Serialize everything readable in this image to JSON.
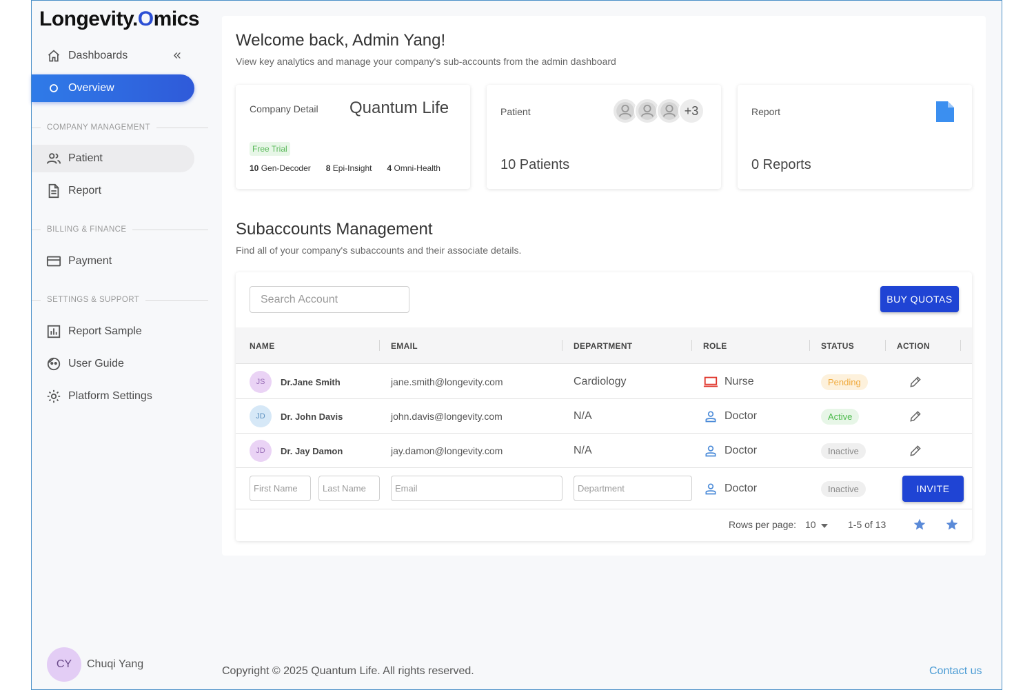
{
  "brand": {
    "part1": "Longevity.",
    "part2": "O",
    "part3": "mics"
  },
  "sidebar": {
    "dashboards": "Dashboards",
    "overview": "Overview",
    "section_company": "COMPANY MANAGEMENT",
    "patient": "Patient",
    "report": "Report",
    "section_billing": "BILLING & FINANCE",
    "payment": "Payment",
    "section_settings": "SETTINGS & SUPPORT",
    "report_sample": "Report Sample",
    "user_guide": "User Guide",
    "platform_settings": "Platform Settings",
    "user_initials": "CY",
    "user_name": "Chuqi Yang"
  },
  "header": {
    "welcome": "Welcome back, Admin Yang!",
    "subtitle": "View key analytics and manage your company's sub-accounts from the admin dashboard"
  },
  "cards": {
    "company": {
      "label": "Company Detail",
      "name": "Quantum Life",
      "badge": "Free Trial",
      "metrics": [
        {
          "count": "10",
          "name": "Gen-Decoder"
        },
        {
          "count": "8",
          "name": "Epi-Insight"
        },
        {
          "count": "4",
          "name": "Omni-Health"
        }
      ]
    },
    "patient": {
      "label": "Patient",
      "more": "+3",
      "value": "10 Patients"
    },
    "report": {
      "label": "Report",
      "value": "0 Reports"
    }
  },
  "subaccounts": {
    "title": "Subaccounts Management",
    "desc": "Find all of your company's subaccounts  and their associate details.",
    "search_placeholder": "Search Account",
    "buy_button": "BUY QUOTAS",
    "columns": [
      "NAME",
      "EMAIL",
      "DEPARTMENT",
      "ROLE",
      "STATUS",
      "ACTION"
    ],
    "rows": [
      {
        "initials": "JS",
        "name": "Dr.Jane Smith",
        "email": "jane.smith@longevity.com",
        "department": "Cardiology",
        "role": "Nurse",
        "role_icon": "laptop-icon",
        "status": "Pending"
      },
      {
        "initials": "JD",
        "name": "Dr. John Davis",
        "email": "john.davis@longevity.com",
        "department": "N/A",
        "role": "Doctor",
        "role_icon": "person-icon",
        "status": "Active"
      },
      {
        "initials": "JD",
        "name": "Dr. Jay Damon",
        "email": "jay.damon@longevity.com",
        "department": "N/A",
        "role": "Doctor",
        "role_icon": "person-icon",
        "status": "Inactive"
      }
    ],
    "invite_row": {
      "first_name_placeholder": "First Name",
      "last_name_placeholder": "Last Name",
      "email_placeholder": "Email",
      "department_placeholder": "Department",
      "role": "Doctor",
      "status": "Inactive",
      "invite_button": "INVITE"
    },
    "pagination": {
      "rows_per_page_label": "Rows per page:",
      "rows_per_page_value": "10",
      "range": "1-5 of 13"
    }
  },
  "footer": {
    "copyright": "Copyright © 2025 Quantum Life. All rights reserved.",
    "contact": "Contact us"
  },
  "colors": {
    "primary": "#1f44d4",
    "accent_gradient_start": "#2f7be8",
    "pending": "#f0a93b",
    "active": "#4cba4c",
    "link": "#4a9bd4"
  }
}
